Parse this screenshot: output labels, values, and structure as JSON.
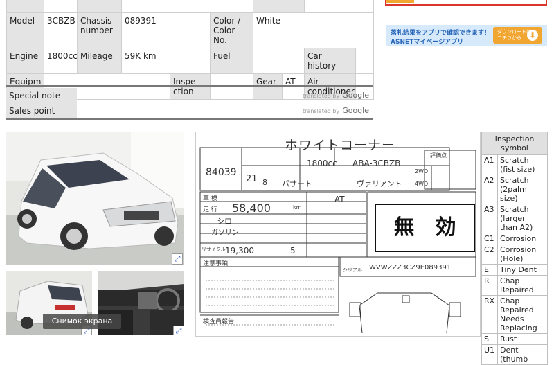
{
  "spec_table": {
    "row1": {
      "model_label": "Model",
      "model_value": "3CBZB",
      "chassis_label": "Chassis number",
      "chassis_value": "089391",
      "color_label": "Color / Color No.",
      "color_value": "White"
    },
    "row2": {
      "engine_label": "Engine",
      "engine_value": "1800cc",
      "mileage_label": "Mileage",
      "mileage_value": "59K km",
      "fuel_label": "Fuel",
      "fuel_value": "",
      "car_history_label": "Car history",
      "car_history_value": ""
    },
    "row3": {
      "equipment_label": "Equipm ent",
      "equipment_value": "",
      "inspection_label": "Inspe ction",
      "inspection_value": "",
      "gear_label": "Gear",
      "gear_value": "AT",
      "air_label": "Air conditioner",
      "air_value": ""
    }
  },
  "notes": {
    "special_note_label": "Special note",
    "sales_point_label": "Sales point",
    "translated_by": "translated by",
    "google": "Google"
  },
  "banner": {
    "line1": "落札結果をアプリで確認できます！",
    "line2": "ASNETマイページアプリ",
    "download_line1": "ダウンロードは",
    "download_line2": "コチラから"
  },
  "photos": {
    "expand_icon": "⤢",
    "tooltip": "Снимок экрана"
  },
  "sheet": {
    "title": "ホワイトコーナー",
    "lot_number": "84039",
    "car_name": "パサート",
    "variant": "ヴァリアント",
    "reg_year": "21",
    "reg_month": "8",
    "displacement": "1800cc",
    "model_code": "ABA-3CBZB",
    "mileage": "58,400",
    "mileage_unit": "km",
    "shift": "AT",
    "color": "シロ",
    "fuel": "ガソリン",
    "recycle": "19,300",
    "seats": "5",
    "chassis": "WVWZZZ3CZ9E089391",
    "stamp": "無　効",
    "labels": {
      "car_inspection": "車 検",
      "run": "走 行",
      "recycle_label": "リサイクル",
      "caution": "注意事項",
      "inspector": "検査員報告",
      "grade": "グレード",
      "chassis_label": "シリアル",
      "evaluation": "評価点",
      "two_wd": "2WD",
      "four_wd": "4WD"
    }
  },
  "symbols": {
    "header": "Inspection symbol",
    "rows": [
      {
        "code": "A1",
        "text": "Scratch (fist size)"
      },
      {
        "code": "A2",
        "text": "Scratch (2palm size)"
      },
      {
        "code": "A3",
        "text": "Scratch (larger than A2)"
      },
      {
        "code": "C1",
        "text": "Corrosion"
      },
      {
        "code": "C2",
        "text": "Corrosion (Hole)"
      },
      {
        "code": "E",
        "text": "Tiny Dent"
      },
      {
        "code": "R",
        "text": "Chap Repaired"
      },
      {
        "code": "RX",
        "text": "Chap Repaired Needs Replacing"
      },
      {
        "code": "S",
        "text": "Rust"
      },
      {
        "code": "U1",
        "text": "Dent (thumb"
      }
    ]
  },
  "colors": {
    "label_bg": "#e4e4e4",
    "banner_bg": "#d7eafc",
    "download_btn": "#f2a632",
    "red_box": "#d9352b"
  }
}
